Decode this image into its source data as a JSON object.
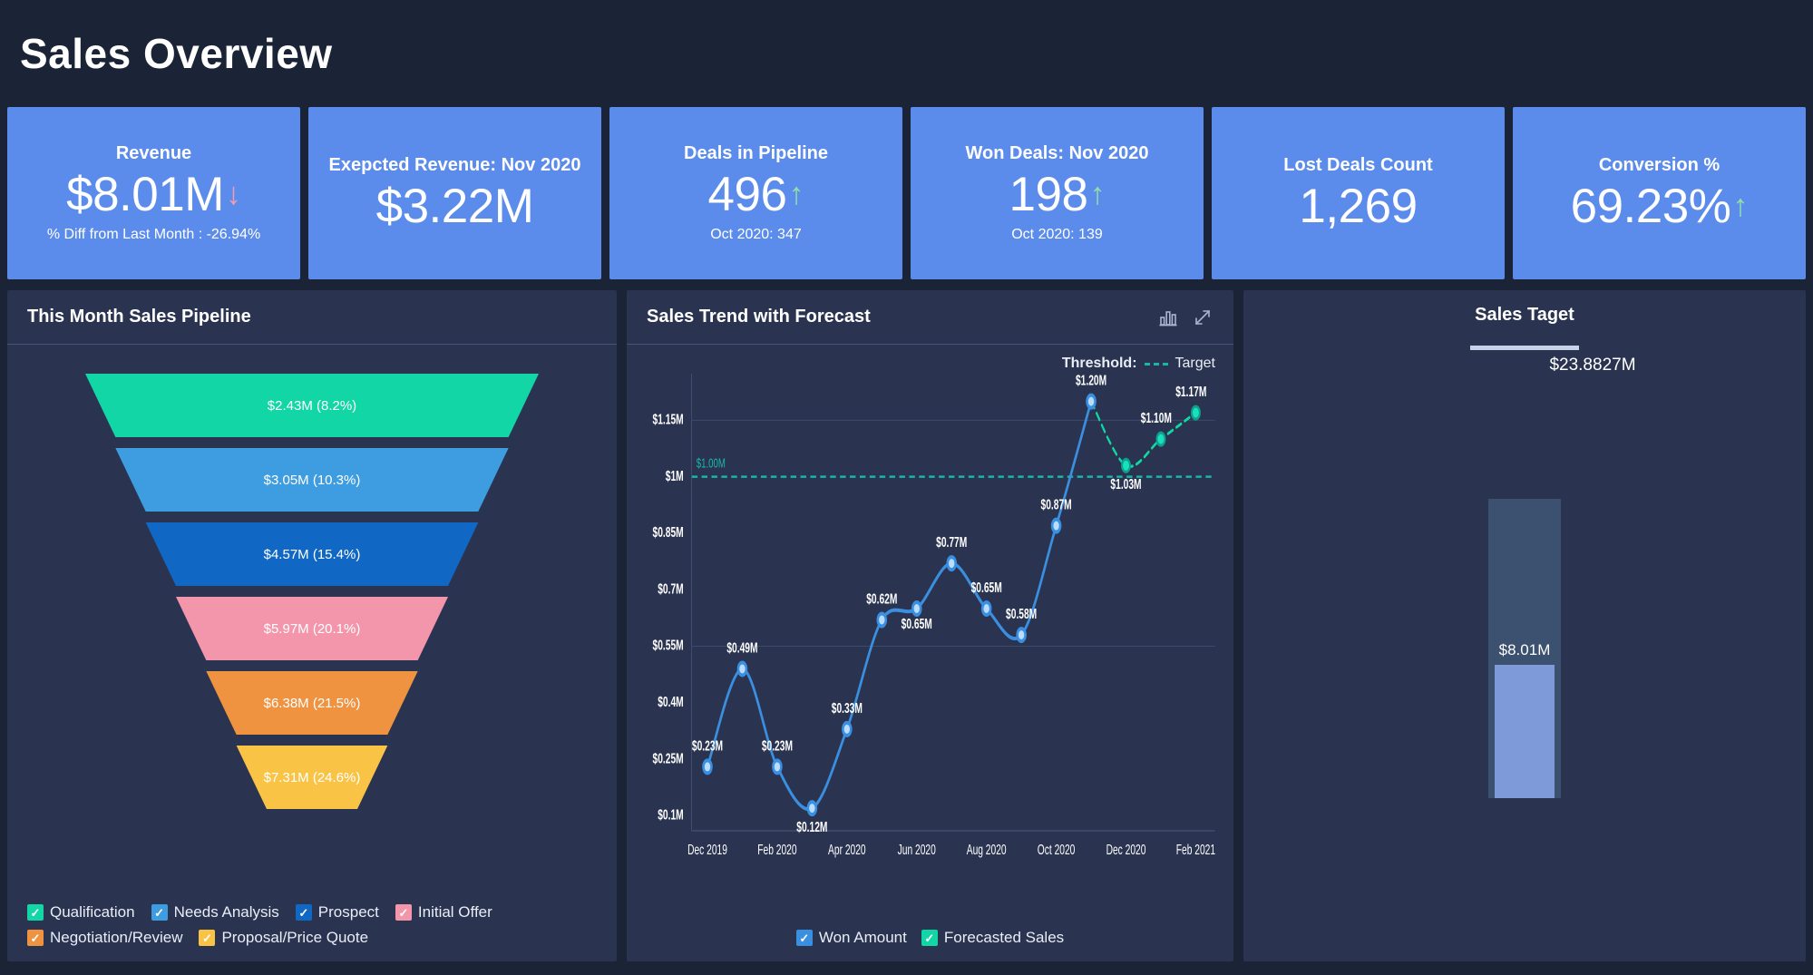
{
  "header": {
    "title": "Sales Overview"
  },
  "kpis": [
    {
      "title": "Revenue",
      "value": "$8.01M",
      "trend": "down",
      "arrow": "↓",
      "sub": "% Diff from Last Month : -26.94%"
    },
    {
      "title": "Exepcted Revenue: Nov 2020",
      "value": "$3.22M",
      "trend": "none",
      "arrow": "",
      "sub": ""
    },
    {
      "title": "Deals in Pipeline",
      "value": "496",
      "trend": "up",
      "arrow": "↑",
      "sub": "Oct 2020: 347"
    },
    {
      "title": "Won Deals: Nov 2020",
      "value": "198",
      "trend": "up",
      "arrow": "↑",
      "sub": "Oct 2020: 139"
    },
    {
      "title": "Lost Deals Count",
      "value": "1,269",
      "trend": "none",
      "arrow": "",
      "sub": ""
    },
    {
      "title": "Conversion %",
      "value": "69.23%",
      "trend": "up",
      "arrow": "↑",
      "sub": ""
    }
  ],
  "funnel_panel": {
    "title": "This Month Sales Pipeline",
    "legend": [
      {
        "label": "Qualification",
        "color": "#12d6a6",
        "check": "✓"
      },
      {
        "label": "Needs Analysis",
        "color": "#3e9ce0",
        "check": "✓"
      },
      {
        "label": "Prospect",
        "color": "#1168c4",
        "check": "✓"
      },
      {
        "label": "Initial Offer",
        "color": "#f396ab",
        "check": "✓"
      },
      {
        "label": "Negotiation/Review",
        "color": "#ef9340",
        "check": "✓"
      },
      {
        "label": "Proposal/Price Quote",
        "color": "#f9c346",
        "check": "✓"
      }
    ]
  },
  "trend_panel": {
    "title": "Sales Trend with Forecast",
    "icons": [
      {
        "name": "bar-chart-icon"
      },
      {
        "name": "expand-icon"
      }
    ],
    "threshold_legend_label": "Threshold:",
    "threshold_legend_series": "Target",
    "legend": [
      {
        "label": "Won Amount",
        "color": "#3a8fe0",
        "check": "✓"
      },
      {
        "label": "Forecasted Sales",
        "color": "#12d6a6",
        "check": "✓"
      }
    ]
  },
  "target_panel": {
    "title": "Sales Taget",
    "target_value": "$23.8827M",
    "actual_value": "$8.01M"
  },
  "chart_data": [
    {
      "type": "funnel",
      "title": "This Month Sales Pipeline",
      "stages": [
        {
          "label": "Qualification",
          "value_label": "$2.43M (8.2%)",
          "value": 2.43,
          "percent": 8.2,
          "color": "#12d6a6"
        },
        {
          "label": "Needs Analysis",
          "value_label": "$3.05M (10.3%)",
          "value": 3.05,
          "percent": 10.3,
          "color": "#3e9ce0"
        },
        {
          "label": "Prospect",
          "value_label": "$4.57M (15.4%)",
          "value": 4.57,
          "percent": 15.4,
          "color": "#1168c4"
        },
        {
          "label": "Initial Offer",
          "value_label": "$5.97M (20.1%)",
          "value": 5.97,
          "percent": 20.1,
          "color": "#f396ab"
        },
        {
          "label": "Negotiation/Review",
          "value_label": "$6.38M (21.5%)",
          "value": 6.38,
          "percent": 21.5,
          "color": "#ef9340"
        },
        {
          "label": "Proposal/Price Quote",
          "value_label": "$7.31M (24.6%)",
          "value": 7.31,
          "percent": 24.6,
          "color": "#f9c346"
        }
      ]
    },
    {
      "type": "line",
      "title": "Sales Trend with Forecast",
      "xlabel": "",
      "ylabel": "",
      "ylim": [
        0.1,
        1.15
      ],
      "yticks": [
        "$1.15M",
        "$1M",
        "$0.85M",
        "$0.7M",
        "$0.55M",
        "$0.4M",
        "$0.25M",
        "$0.1M"
      ],
      "ytick_values": [
        1.15,
        1.0,
        0.85,
        0.7,
        0.55,
        0.4,
        0.25,
        0.1
      ],
      "xticks": [
        "Dec 2019",
        "Feb 2020",
        "Apr 2020",
        "Jun 2020",
        "Aug 2020",
        "Oct 2020",
        "Dec 2020",
        "Feb 2021"
      ],
      "x": [
        "Dec 2019",
        "Jan 2020",
        "Feb 2020",
        "Mar 2020",
        "Apr 2020",
        "May 2020",
        "Jun 2020",
        "Jul 2020",
        "Aug 2020",
        "Sep 2020",
        "Oct 2020",
        "Nov 2020",
        "Dec 2020",
        "Jan 2021",
        "Feb 2021"
      ],
      "series": [
        {
          "name": "Won Amount",
          "color": "#3a8fe0",
          "labels": [
            "$0.23M",
            "$0.49M",
            "$0.23M",
            "$0.12M",
            "$0.33M",
            "$0.62M",
            "$0.65M",
            "$0.77M",
            "$0.65M",
            "$0.58M",
            "$0.87M",
            "$1.20M"
          ],
          "values": [
            0.23,
            0.49,
            0.23,
            0.12,
            0.33,
            0.62,
            0.65,
            0.77,
            0.65,
            0.58,
            0.87,
            1.2
          ]
        },
        {
          "name": "Forecasted Sales",
          "color": "#12d6a6",
          "labels": [
            "$1.03M",
            "$1.10M",
            "$1.17M"
          ],
          "values": [
            1.03,
            1.1,
            1.17
          ],
          "start_index": 12
        }
      ],
      "threshold": {
        "label": "$1.00M",
        "value": 1.0,
        "color": "#19b6a8",
        "series_name": "Target"
      },
      "grid": true,
      "legend_position": "bottom"
    },
    {
      "type": "bullet",
      "title": "Sales Taget",
      "target_label": "$23.8827M",
      "target": 23.8827,
      "actual_label": "$8.01M",
      "actual": 8.01
    }
  ]
}
